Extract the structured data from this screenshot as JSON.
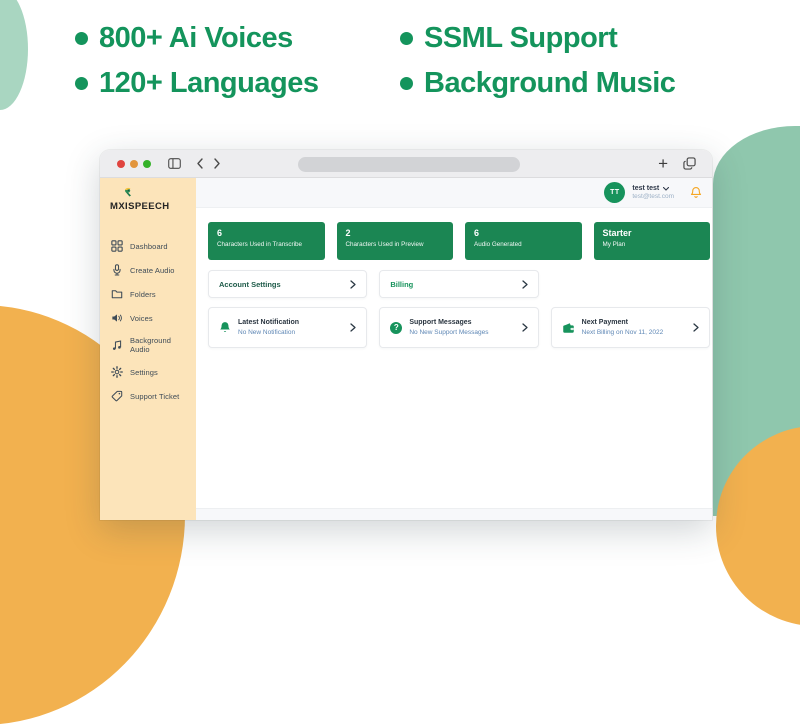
{
  "hero": {
    "features": [
      "800+ Ai Voices",
      "SSML Support",
      "120+ Languages",
      "Background Music"
    ]
  },
  "browser": {
    "url_value": "",
    "new_tab_glyph": "+"
  },
  "app": {
    "logo_text": "MXISPEECH",
    "sidebar": {
      "items": [
        {
          "icon": "dashboard-icon",
          "label": "Dashboard"
        },
        {
          "icon": "microphone-icon",
          "label": "Create Audio"
        },
        {
          "icon": "folder-icon",
          "label": "Folders"
        },
        {
          "icon": "speaker-icon",
          "label": "Voices"
        },
        {
          "icon": "music-note-icon",
          "label": "Background Audio"
        },
        {
          "icon": "gear-icon",
          "label": "Settings"
        },
        {
          "icon": "tag-icon",
          "label": "Support Ticket"
        }
      ]
    },
    "header": {
      "avatar_initials": "TT",
      "user_name": "test test",
      "user_email": "test@test.com"
    },
    "stats": {
      "cards": [
        {
          "value": "6",
          "label": "Characters Used in Transcribe"
        },
        {
          "value": "2",
          "label": "Characters Used in Preview"
        },
        {
          "value": "6",
          "label": "Audio Generated"
        },
        {
          "value": "Starter",
          "label": "My Plan"
        }
      ]
    },
    "quick_links": {
      "cards": [
        {
          "label": "Account Settings"
        },
        {
          "label": "Billing"
        }
      ]
    },
    "info_cards": {
      "cards": [
        {
          "icon": "bell-icon",
          "title": "Latest Notification",
          "subtitle": "No New Notification"
        },
        {
          "icon": "question-icon",
          "glyph": "?",
          "title": "Support Messages",
          "subtitle": "No New Support Messages"
        },
        {
          "icon": "wallet-icon",
          "title": "Next Payment",
          "subtitle": "Next Billing on Nov 11, 2022"
        }
      ]
    }
  },
  "colors": {
    "brand_green": "#14945c",
    "card_green": "#1b8653",
    "sidebar_cream": "#fce4ba",
    "blob_orange": "#f2b14f",
    "blob_teal": "#8fc7ad",
    "blob_mint": "#a9d6c1",
    "link_blue": "#5e87b5",
    "bell_orange": "#f5a623"
  }
}
